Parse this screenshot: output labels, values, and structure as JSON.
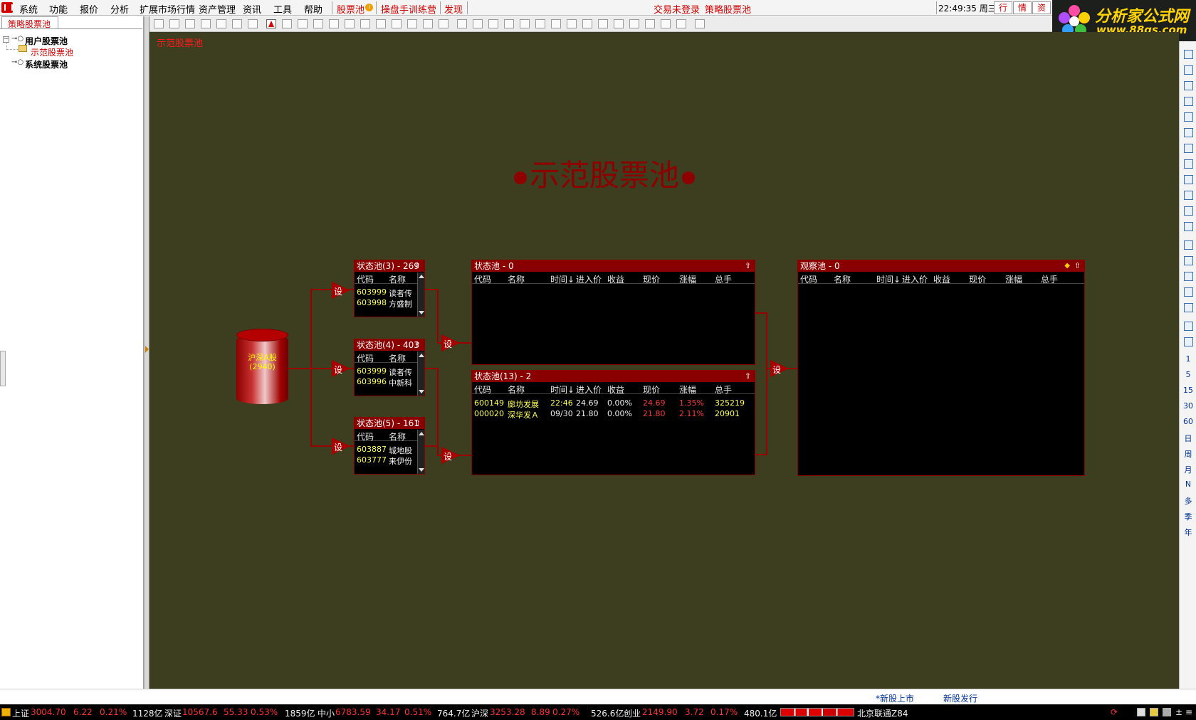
{
  "menubar": {
    "items": [
      "系统",
      "功能",
      "报价",
      "分析",
      "扩展市场行情",
      "资产管理",
      "资讯",
      "工具",
      "帮助"
    ],
    "red_items": [
      "股票池",
      "操盘手训练营",
      "发现"
    ],
    "status_login": "交易未登录",
    "status_module": "策略股票池",
    "clock": "22:49:35 周三",
    "right_buttons": [
      "行",
      "情",
      "资"
    ]
  },
  "brand": {
    "title": "分析家公式网",
    "url": "www.88gs.com"
  },
  "left_panel": {
    "tab": "策略股票池",
    "tree": [
      {
        "label": "用户股票池",
        "bold": true
      },
      {
        "label": "示范股票池",
        "bold": false
      },
      {
        "label": "系统股票池",
        "bold": true
      }
    ]
  },
  "canvas": {
    "label": "示范股票池",
    "title": "示范股票池",
    "source": {
      "label": "沪深A股",
      "count": "(2940)"
    },
    "set_label": "设",
    "small_pools": [
      {
        "title": "状态池(3) - 269",
        "cols": [
          "代码",
          "名称"
        ],
        "rows": [
          [
            "603999",
            "读者传"
          ],
          [
            "603998",
            "方盛制"
          ]
        ]
      },
      {
        "title": "状态池(4) - 403",
        "cols": [
          "代码",
          "名称"
        ],
        "rows": [
          [
            "603999",
            "读者传"
          ],
          [
            "603996",
            "中新科"
          ]
        ]
      },
      {
        "title": "状态池(5) - 161",
        "cols": [
          "代码",
          "名称"
        ],
        "rows": [
          [
            "603887",
            "城地股"
          ],
          [
            "603777",
            "来伊份"
          ]
        ]
      }
    ],
    "big_pools": [
      {
        "title": "状态池 - 0",
        "cols": [
          "代码",
          "名称",
          "时间↓",
          "进入价",
          "收益",
          "现价",
          "涨幅",
          "总手"
        ],
        "rows": []
      },
      {
        "title": "状态池(13) - 2",
        "cols": [
          "代码",
          "名称",
          "时间↓",
          "进入价",
          "收益",
          "现价",
          "涨幅",
          "总手"
        ],
        "rows": [
          [
            "600149",
            "廊坊发展",
            "22:46",
            "24.69",
            "0.00%",
            "24.69",
            "1.35%",
            "325219"
          ],
          [
            "000020",
            "深华发Ａ",
            "09/30",
            "21.80",
            "0.00%",
            "21.80",
            "2.11%",
            "20901"
          ]
        ]
      }
    ],
    "watch_pool": {
      "title": "观察池 - 0",
      "cols": [
        "代码",
        "名称",
        "时间↓",
        "进入价",
        "收益",
        "现价",
        "涨幅",
        "总手"
      ],
      "rows": []
    }
  },
  "right_toolbar": {
    "periods": [
      "1",
      "5",
      "15",
      "30",
      "60",
      "日",
      "周",
      "月",
      "N",
      "多",
      "季",
      "年"
    ]
  },
  "subbar": {
    "links": [
      "*新股上市",
      "新股发行"
    ]
  },
  "statusbar": {
    "segments": [
      {
        "name": "上证",
        "price": "3004.70",
        "change": "6.22",
        "pct": "0.21%",
        "amount": "1128亿"
      },
      {
        "name": "深证",
        "price": "10567.6",
        "change": "55.33",
        "pct": "0.53%",
        "amount": "1859亿"
      },
      {
        "name": "中小",
        "price": "6783.59",
        "change": "34.17",
        "pct": "0.51%",
        "amount": "764.7亿"
      },
      {
        "name": "沪深",
        "price": "3253.28",
        "change": "8.89",
        "pct": "0.27%",
        "amount": "526.6亿"
      },
      {
        "name": "创业",
        "price": "2149.90",
        "change": "3.72",
        "pct": "0.17%",
        "amount": "480.1亿"
      }
    ],
    "server": "北京联通Z84"
  },
  "colors": {
    "canvas_bg": "#3d3d20",
    "pool_header": "#8a0000",
    "quote_red": "#ff3030",
    "brand_yellow": "#ffd400"
  }
}
